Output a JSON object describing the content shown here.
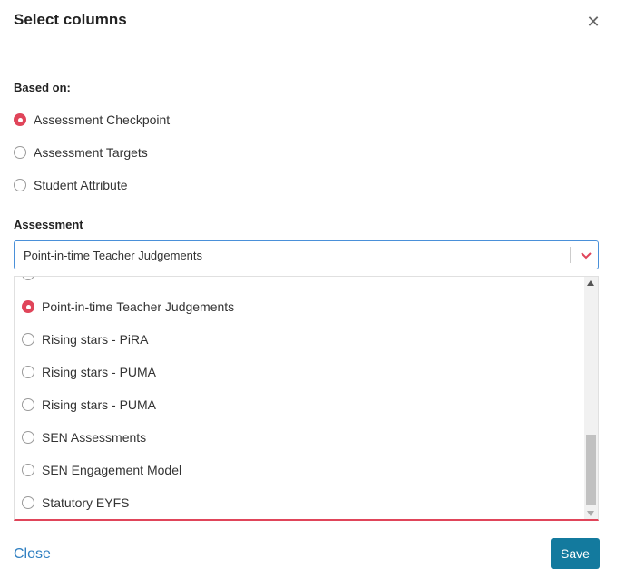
{
  "dialog": {
    "title": "Select columns",
    "close_icon": "close-icon"
  },
  "based_on": {
    "label": "Based on:",
    "options": [
      {
        "label": "Assessment Checkpoint",
        "selected": true
      },
      {
        "label": "Assessment Targets",
        "selected": false
      },
      {
        "label": "Student Attribute",
        "selected": false
      }
    ]
  },
  "assessment": {
    "label": "Assessment",
    "selected_value": "Point-in-time Teacher Judgements",
    "chevron_icon": "chevron-down-icon",
    "options": [
      {
        "label": "Point-in-time Teacher Judgements",
        "selected": true
      },
      {
        "label": "Rising stars - PiRA",
        "selected": false
      },
      {
        "label": "Rising stars - PUMA",
        "selected": false
      },
      {
        "label": "Rising stars - PUMA",
        "selected": false
      },
      {
        "label": "SEN Assessments",
        "selected": false
      },
      {
        "label": "SEN Engagement Model",
        "selected": false
      },
      {
        "label": "Statutory EYFS",
        "selected": false
      }
    ]
  },
  "footer": {
    "close_label": "Close",
    "save_label": "Save"
  },
  "colors": {
    "accent_red": "#e0455a",
    "link_blue": "#2f7fc1",
    "save_button": "#137a9e",
    "focus_border": "#4a90d9"
  }
}
